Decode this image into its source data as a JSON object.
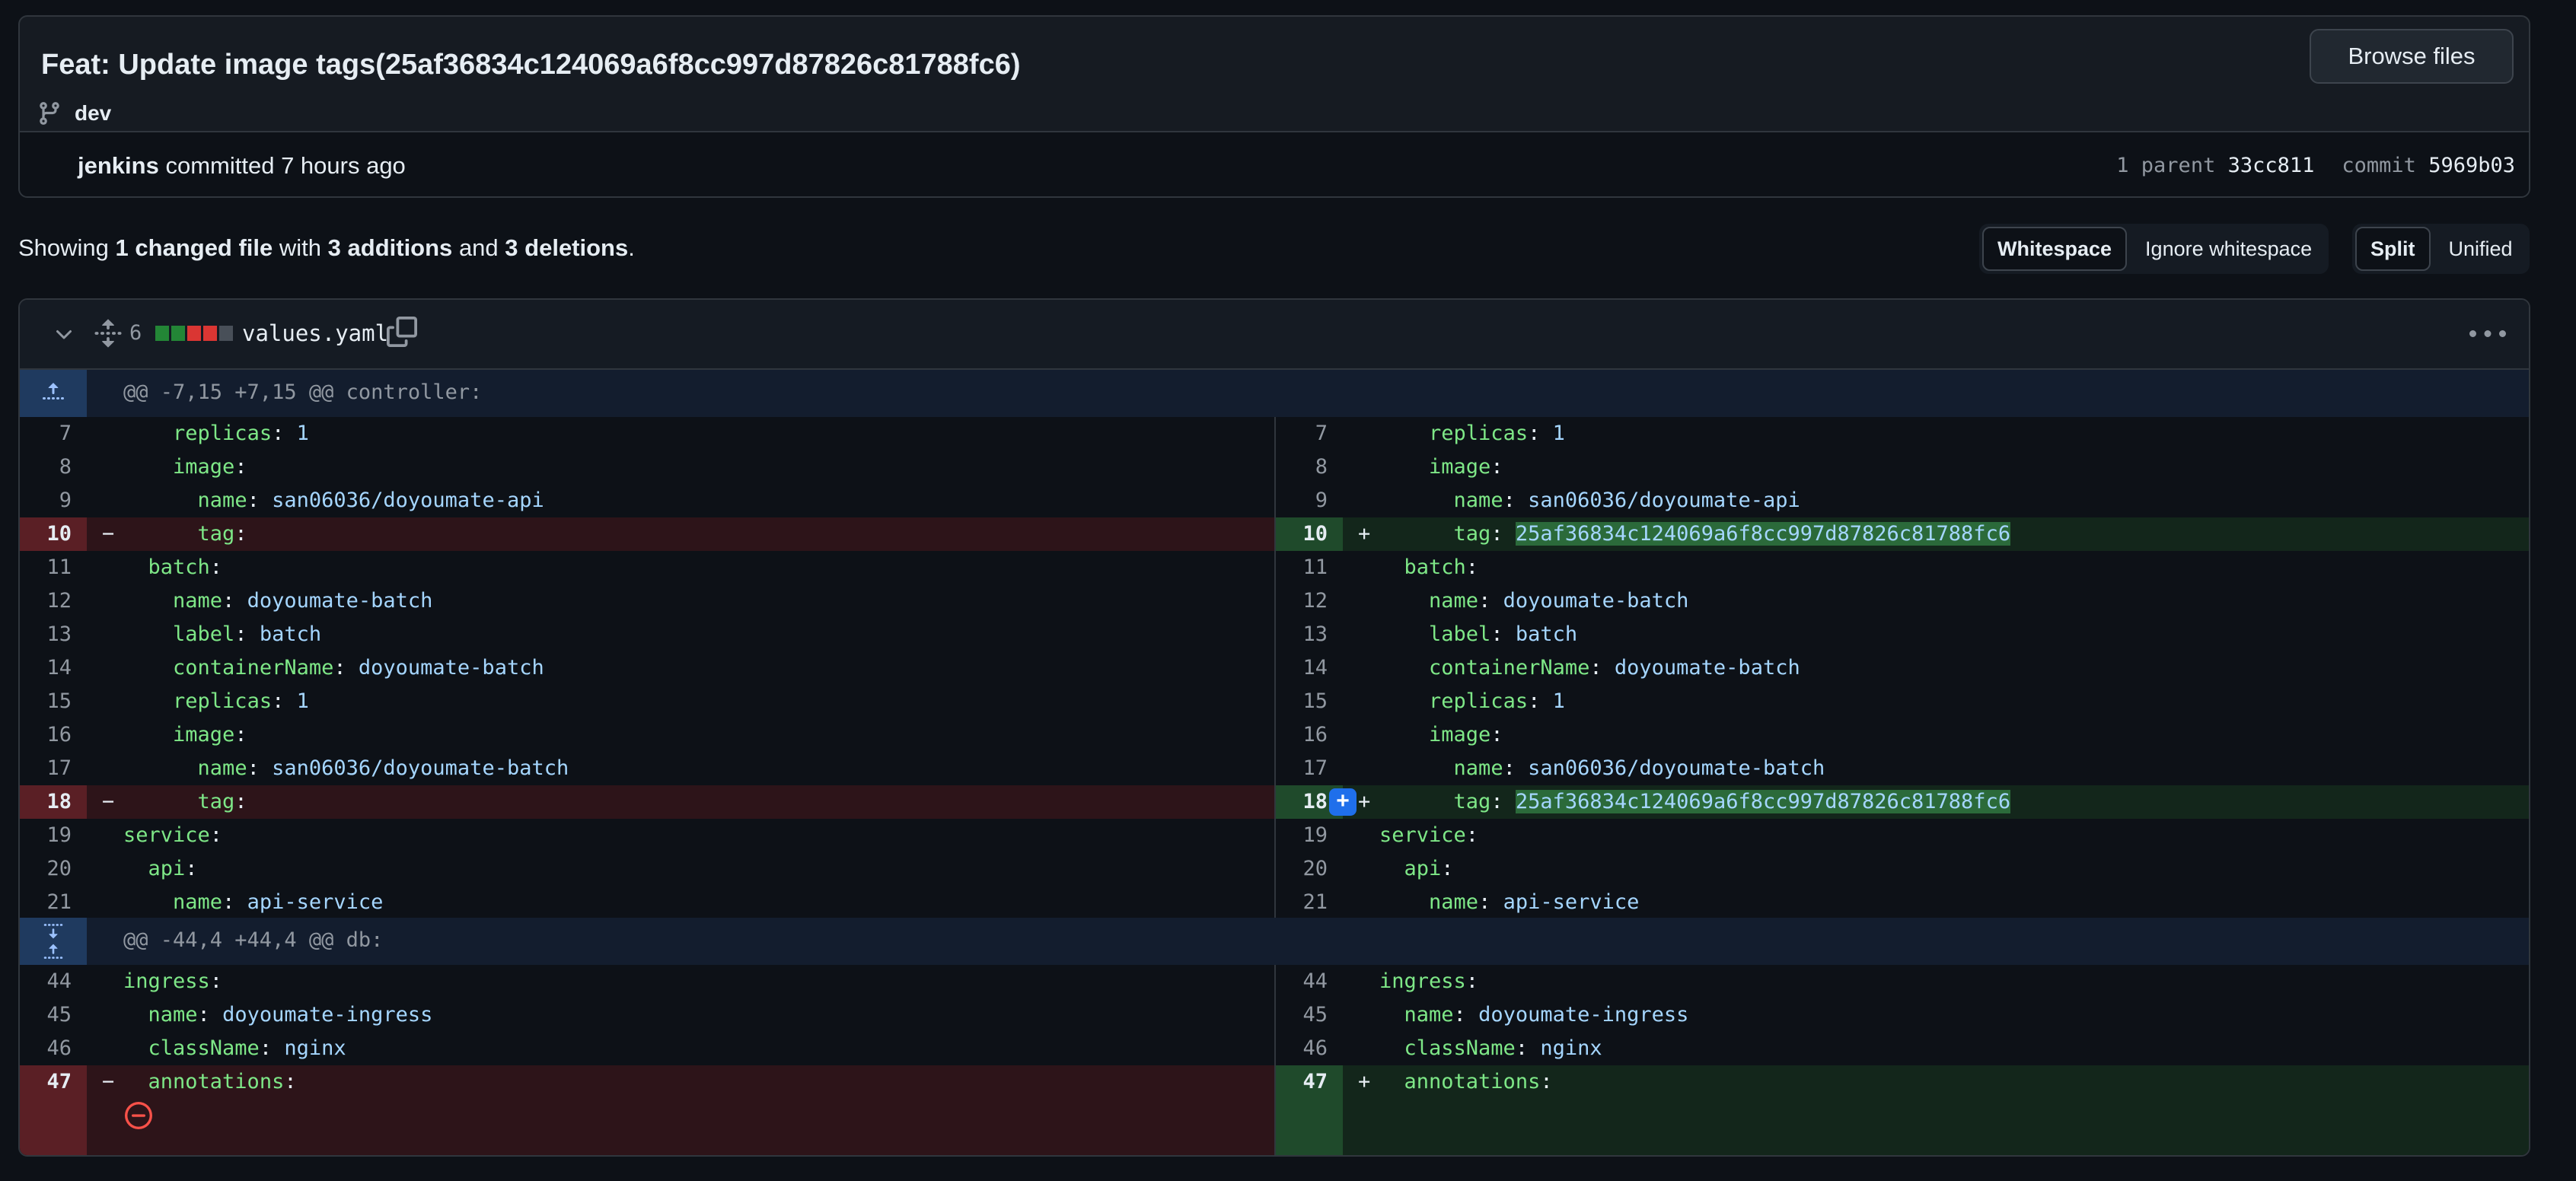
{
  "commit": {
    "title": "Feat: Update image tags(25af36834c124069a6f8cc997d87826c81788fc6)",
    "branch": "dev",
    "browse_label": "Browse files",
    "author": "jenkins",
    "committed_text": "committed",
    "time": "7 hours ago",
    "parent_label": "1 parent",
    "parent_sha": "33cc811",
    "commit_label": "commit",
    "commit_sha": "5969b03"
  },
  "summary": {
    "prefix": "Showing",
    "changed": "1 changed file",
    "with": "with",
    "additions": "3 additions",
    "and": "and",
    "deletions": "3 deletions",
    "end": "."
  },
  "view_options": {
    "whitespace": "Whitespace",
    "ignore_whitespace": "Ignore whitespace",
    "split": "Split",
    "unified": "Unified"
  },
  "file": {
    "changes": "6",
    "name": "values.yaml",
    "hunk1": "@@ -7,15 +7,15 @@ controller:",
    "hunk2": "@@ -44,4 +44,4 @@ db:"
  },
  "lines": {
    "l7": {
      "num": "7",
      "indent": "    ",
      "key": "replicas",
      "val": " 1"
    },
    "l8": {
      "num": "8",
      "indent": "    ",
      "key": "image",
      "val": ""
    },
    "l9": {
      "num": "9",
      "indent": "      ",
      "key": "name",
      "val": " san06036/doyoumate-api"
    },
    "l10_old": {
      "num": "10",
      "marker": "−",
      "indent": "      ",
      "key": "tag",
      "val": ""
    },
    "l10_new": {
      "num": "10",
      "marker": "+",
      "indent": "      ",
      "key": "tag",
      "val": "25af36834c124069a6f8cc997d87826c81788fc6"
    },
    "l11": {
      "num": "11",
      "indent": "  ",
      "key": "batch",
      "val": ""
    },
    "l12": {
      "num": "12",
      "indent": "    ",
      "key": "name",
      "val": " doyoumate-batch"
    },
    "l13": {
      "num": "13",
      "indent": "    ",
      "key": "label",
      "val": " batch"
    },
    "l14": {
      "num": "14",
      "indent": "    ",
      "key": "containerName",
      "val": " doyoumate-batch"
    },
    "l15": {
      "num": "15",
      "indent": "    ",
      "key": "replicas",
      "val": " 1"
    },
    "l16": {
      "num": "16",
      "indent": "    ",
      "key": "image",
      "val": ""
    },
    "l17": {
      "num": "17",
      "indent": "      ",
      "key": "name",
      "val": " san06036/doyoumate-batch"
    },
    "l18_old": {
      "num": "18",
      "marker": "−",
      "indent": "      ",
      "key": "tag",
      "val": ""
    },
    "l18_new": {
      "num": "18",
      "marker": "+",
      "indent": "      ",
      "key": "tag",
      "val": "25af36834c124069a6f8cc997d87826c81788fc6"
    },
    "l19": {
      "num": "19",
      "indent": "",
      "key": "service",
      "val": ""
    },
    "l20": {
      "num": "20",
      "indent": "  ",
      "key": "api",
      "val": ""
    },
    "l21": {
      "num": "21",
      "indent": "    ",
      "key": "name",
      "val": " api-service"
    },
    "l44": {
      "num": "44",
      "indent": "",
      "key": "ingress",
      "val": ""
    },
    "l45": {
      "num": "45",
      "indent": "  ",
      "key": "name",
      "val": " doyoumate-ingress"
    },
    "l46": {
      "num": "46",
      "indent": "  ",
      "key": "className",
      "val": " nginx"
    },
    "l47_old": {
      "num": "47",
      "marker": "−",
      "indent": "  ",
      "key": "annotations",
      "val": ""
    },
    "l47_new": {
      "num": "47",
      "marker": "+",
      "indent": "  ",
      "key": "annotations",
      "val": ""
    }
  },
  "colors": {
    "deletion_bg": "#2d1419",
    "addition_bg": "#13261b",
    "key": "#7ee787",
    "value": "#a5d6ff",
    "accent": "#1f6feb"
  }
}
